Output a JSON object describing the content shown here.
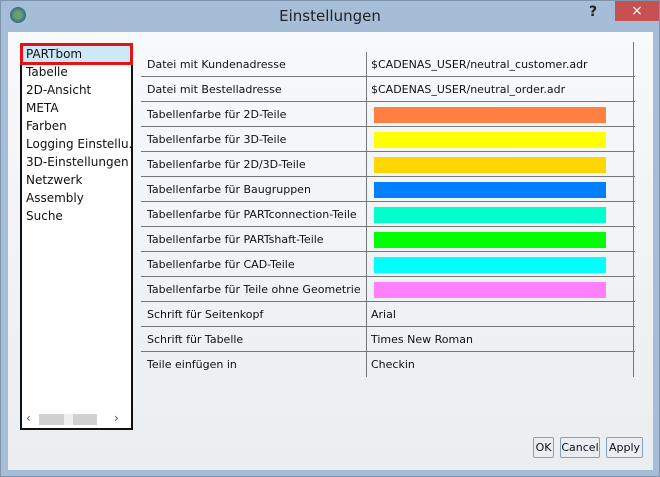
{
  "window": {
    "title": "Einstellungen",
    "help_label": "?",
    "close_label": "×",
    "icon": "app-icon"
  },
  "nav": {
    "items": [
      {
        "label": "PARTbom",
        "selected": true
      },
      {
        "label": "Tabelle"
      },
      {
        "label": "2D-Ansicht"
      },
      {
        "label": "META"
      },
      {
        "label": "Farben"
      },
      {
        "label": "Logging Einstellu..."
      },
      {
        "label": "3D-Einstellungen"
      },
      {
        "label": "Netzwerk"
      },
      {
        "label": "Assembly"
      },
      {
        "label": "Suche"
      }
    ],
    "scroll_left": "‹",
    "scroll_right": "›"
  },
  "settings": [
    {
      "label": "Datei mit Kundenadresse",
      "value": "$CADENAS_USER/neutral_customer.adr"
    },
    {
      "label": "Datei mit Bestelladresse",
      "value": "$CADENAS_USER/neutral_order.adr"
    },
    {
      "label": "Tabellenfarbe für 2D-Teile",
      "color": "#ff8040"
    },
    {
      "label": "Tabellenfarbe für 3D-Teile",
      "color": "#ffff00"
    },
    {
      "label": "Tabellenfarbe für 2D/3D-Teile",
      "color": "#ffd700"
    },
    {
      "label": "Tabellenfarbe für Baugruppen",
      "color": "#0080ff"
    },
    {
      "label": "Tabellenfarbe für PARTconnection-Teile",
      "color": "#00ffcc"
    },
    {
      "label": "Tabellenfarbe für PARTshaft-Teile",
      "color": "#00ff00"
    },
    {
      "label": "Tabellenfarbe für CAD-Teile",
      "color": "#00ffff"
    },
    {
      "label": "Tabellenfarbe für Teile ohne Geometrie",
      "color": "#ff80ff"
    },
    {
      "label": "Schrift für Seitenkopf",
      "value": "Arial"
    },
    {
      "label": "Schrift für Tabelle",
      "value": "Times New Roman"
    },
    {
      "label": "Teile einfügen in",
      "value": "Checkin"
    }
  ],
  "buttons": {
    "ok": "OK",
    "cancel": "Cancel",
    "apply": "Apply"
  }
}
